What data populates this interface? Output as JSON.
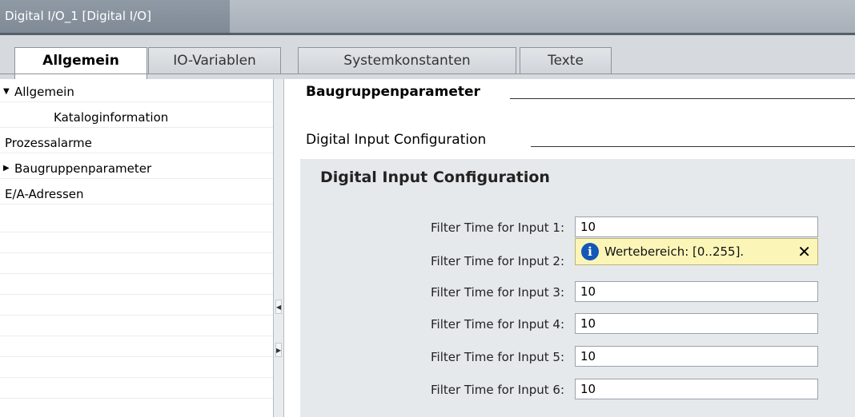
{
  "window": {
    "title": "Digital I/O_1 [Digital I/O]"
  },
  "tabs": [
    {
      "label": "Allgemein",
      "active": true
    },
    {
      "label": "IO-Variablen",
      "active": false
    },
    {
      "label": "Systemkonstanten",
      "active": false
    },
    {
      "label": "Texte",
      "active": false
    }
  ],
  "nav": {
    "items": [
      {
        "label": "Allgemein",
        "expanded": true
      },
      {
        "label": "Kataloginformation"
      },
      {
        "label": "Prozessalarme"
      },
      {
        "label": "Baugruppenparameter",
        "selected": true
      },
      {
        "label": "E/A-Adressen"
      }
    ],
    "expanded_icon": "triangle-down-icon",
    "selected_icon": "triangle-right-icon"
  },
  "content": {
    "section_title": "Baugruppenparameter",
    "subsection_title": "Digital Input Configuration",
    "panel_title": "Digital Input Configuration",
    "params": [
      {
        "label": "Filter Time for Input 1:",
        "value": "10"
      },
      {
        "label": "Filter Time for Input 2:",
        "value": ""
      },
      {
        "label": "Filter Time for Input 3:",
        "value": "10"
      },
      {
        "label": "Filter Time for Input 4:",
        "value": "10"
      },
      {
        "label": "Filter Time for Input 5:",
        "value": "10"
      },
      {
        "label": "Filter Time for Input 6:",
        "value": "10"
      }
    ],
    "tooltip": {
      "message": "Wertebereich: [0..255].",
      "icon": "info-icon",
      "close": "✕"
    }
  },
  "colors": {
    "tooltip_bg": "#fbf6b8",
    "info_blue": "#1357b7",
    "panel_bg": "#e6e9ec"
  }
}
